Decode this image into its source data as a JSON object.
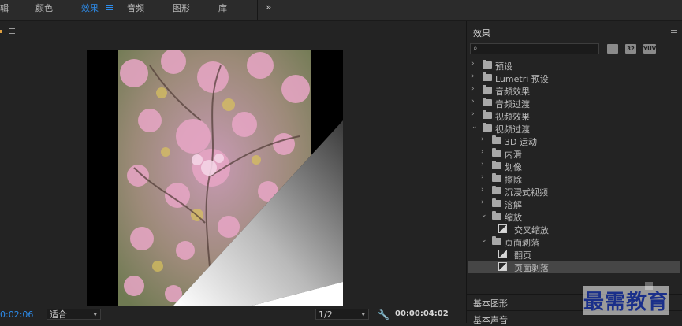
{
  "tabs": [
    {
      "label": "辑",
      "active": false
    },
    {
      "label": "颜色",
      "active": false
    },
    {
      "label": "效果",
      "active": true
    },
    {
      "label": "音频",
      "active": false
    },
    {
      "label": "图形",
      "active": false
    },
    {
      "label": "库",
      "active": false
    }
  ],
  "more_icon": "»",
  "monitor": {
    "current_timecode": "0:02:06",
    "fit_option": "适合",
    "resolution_option": "1/2",
    "duration_timecode": "00:00:04:02",
    "settings_icon": "wrench-icon"
  },
  "effects_panel": {
    "title": "效果",
    "search": {
      "value": "",
      "placeholder": ""
    },
    "toolbar_badges": [
      "32",
      "YUV"
    ],
    "tree": [
      {
        "label": "预设",
        "level": 0,
        "expanded": false,
        "kind": "folder-star"
      },
      {
        "label": "Lumetri 预设",
        "level": 0,
        "expanded": false,
        "kind": "folder-star"
      },
      {
        "label": "音频效果",
        "level": 0,
        "expanded": false,
        "kind": "folder"
      },
      {
        "label": "音频过渡",
        "level": 0,
        "expanded": false,
        "kind": "folder"
      },
      {
        "label": "视频效果",
        "level": 0,
        "expanded": false,
        "kind": "folder"
      },
      {
        "label": "视频过渡",
        "level": 0,
        "expanded": true,
        "kind": "folder"
      },
      {
        "label": "3D 运动",
        "level": 1,
        "expanded": false,
        "kind": "folder"
      },
      {
        "label": "内滑",
        "level": 1,
        "expanded": false,
        "kind": "folder"
      },
      {
        "label": "划像",
        "level": 1,
        "expanded": false,
        "kind": "folder"
      },
      {
        "label": "擦除",
        "level": 1,
        "expanded": false,
        "kind": "folder"
      },
      {
        "label": "沉浸式视频",
        "level": 1,
        "expanded": false,
        "kind": "folder"
      },
      {
        "label": "溶解",
        "level": 1,
        "expanded": false,
        "kind": "folder"
      },
      {
        "label": "缩放",
        "level": 1,
        "expanded": true,
        "kind": "folder"
      },
      {
        "label": "交叉缩放",
        "level": 2,
        "kind": "effect"
      },
      {
        "label": "页面剥落",
        "level": 1,
        "expanded": true,
        "kind": "folder"
      },
      {
        "label": "翻页",
        "level": 2,
        "kind": "effect"
      },
      {
        "label": "页面剥落",
        "level": 2,
        "kind": "effect",
        "selected": true
      }
    ],
    "sections": [
      "基本图形",
      "基本声音"
    ]
  },
  "watermark": "最需教育",
  "colors": {
    "accent": "#2d8ceb",
    "panel_bg": "#232323",
    "selected_row": "#464646"
  }
}
